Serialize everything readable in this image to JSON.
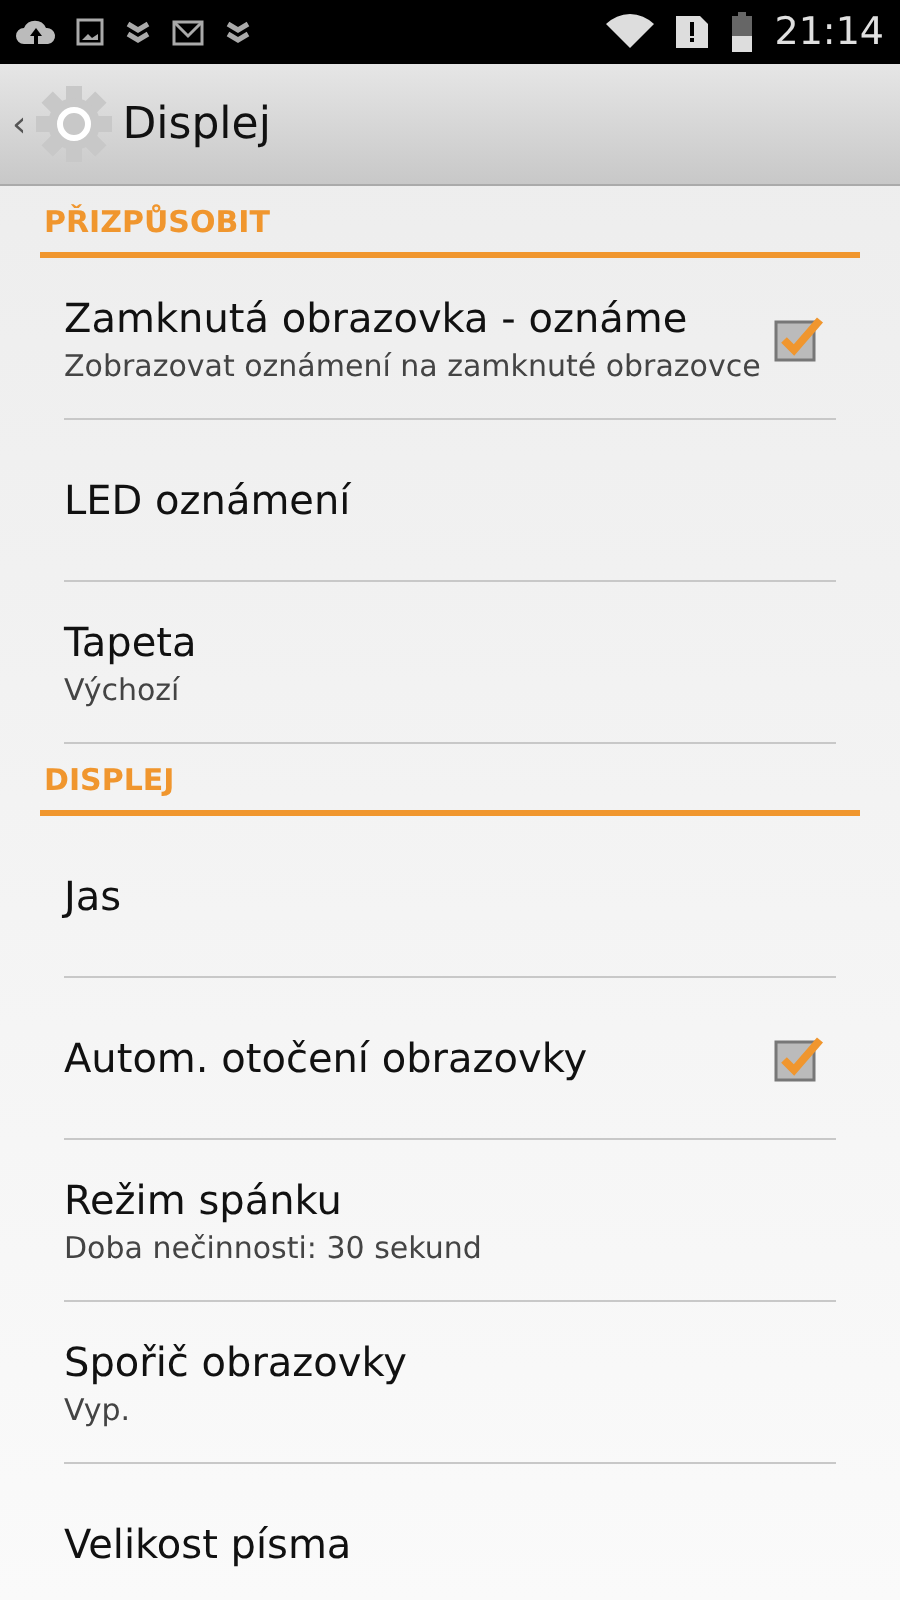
{
  "status_bar": {
    "time": "21:14"
  },
  "action_bar": {
    "back": "‹",
    "title": "Displej"
  },
  "sections": [
    {
      "header": "PŘIZPŮSOBIT",
      "items": [
        {
          "kind": "checkbox",
          "title": "Zamknutá obrazovka - oznáme",
          "summary": "Zobrazovat oznámení na zamknuté obrazovce",
          "checked": true
        },
        {
          "kind": "plain",
          "title": "LED oznámení"
        },
        {
          "kind": "plain",
          "title": "Tapeta",
          "summary": "Výchozí"
        }
      ]
    },
    {
      "header": "DISPLEJ",
      "items": [
        {
          "kind": "plain",
          "title": "Jas"
        },
        {
          "kind": "checkbox",
          "title": "Autom. otočení obrazovky",
          "checked": true
        },
        {
          "kind": "plain",
          "title": "Režim spánku",
          "summary": "Doba nečinnosti: 30 sekund"
        },
        {
          "kind": "plain",
          "title": "Spořič obrazovky",
          "summary": "Vyp."
        },
        {
          "kind": "plain",
          "title": "Velikost písma"
        }
      ]
    }
  ]
}
